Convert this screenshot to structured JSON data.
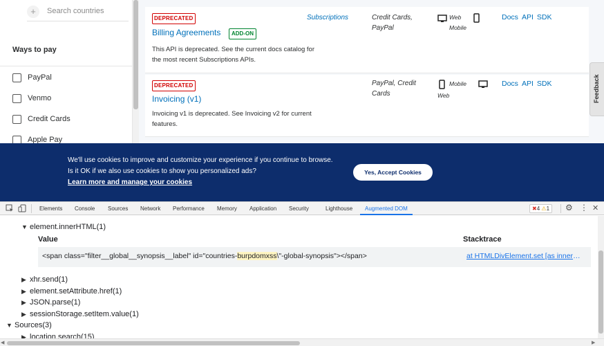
{
  "sidebar": {
    "search_placeholder": "Search countries",
    "ways_title": "Ways to pay",
    "pay_items": [
      {
        "label": "PayPal"
      },
      {
        "label": "Venmo"
      },
      {
        "label": "Credit Cards"
      },
      {
        "label": "Apple Pay"
      }
    ]
  },
  "cards": [
    {
      "badge": "DEPRECATED",
      "title": "Billing Agreements",
      "addon": "ADD-ON",
      "description": "This API is deprecated. See the current docs catalog for the most recent Subscriptions APIs.",
      "use_case": "Subscriptions",
      "funding": "Credit Cards, PayPal",
      "platform": "Web Mobile",
      "links": [
        "Docs",
        "API",
        "SDK"
      ]
    },
    {
      "badge": "DEPRECATED",
      "title": "Invoicing (v1)",
      "description": "Invoicing v1 is deprecated. See Invoicing v2 for current features.",
      "use_case": "",
      "funding": "PayPal, Credit Cards",
      "platform_a": "Mobile",
      "platform_b": "Web",
      "links": [
        "Docs",
        "API",
        "SDK"
      ]
    }
  ],
  "feedback_label": "Feedback",
  "cookie": {
    "message": "We'll use cookies to improve and customize your experience if you continue to browse. Is it OK if we also use cookies to show you personalized ads?",
    "learn_more": "Learn more and manage your cookies",
    "accept": "Yes, Accept Cookies"
  },
  "devtools": {
    "tabs": [
      "Elements",
      "Console",
      "Sources",
      "Network",
      "Performance",
      "Memory",
      "Application",
      "Security",
      "Lighthouse",
      "Augmented DOM"
    ],
    "active_tab": "Augmented DOM",
    "errors": "4",
    "warnings": "1",
    "tree": {
      "inner_html": "element.innerHTML(1)",
      "value_header": "Value",
      "stack_header": "Stacktrace",
      "value_pre": "<span class=\"filter__global__synopsis__label\" id=\"countries-",
      "value_hl": "burpdomxss",
      "value_post": "\\\"-global-synopsis\"></span>",
      "stack_value": "at HTMLDivElement.set [as innerHTML]",
      "items": [
        "xhr.send(1)",
        "element.setAttribute.href(1)",
        "JSON.parse(1)",
        "sessionStorage.setItem.value(1)"
      ],
      "sources": "Sources(3)",
      "location": "location.search(15)"
    }
  },
  "colors": {
    "brand_blue": "#0070ba",
    "banner_navy": "#0d2d6c",
    "deprecated_red": "#d20000",
    "addon_green": "#00842f",
    "devtools_active": "#1a73e8"
  }
}
